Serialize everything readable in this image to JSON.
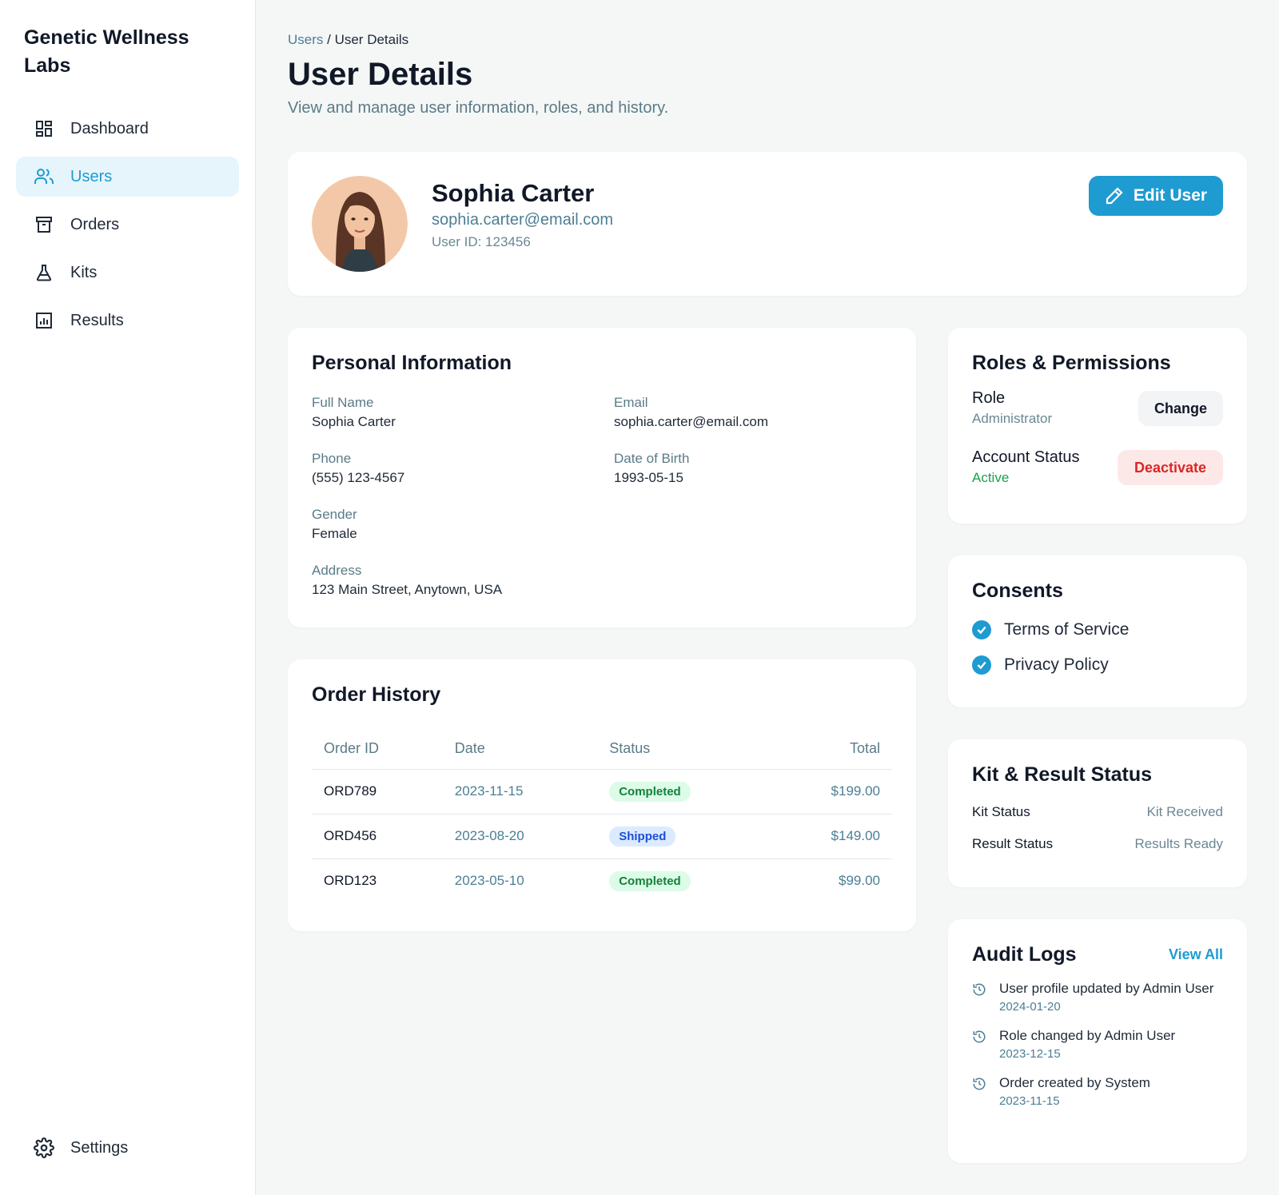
{
  "brand": "Genetic Wellness Labs",
  "nav": {
    "items": [
      {
        "label": "Dashboard",
        "icon": "dashboard-icon"
      },
      {
        "label": "Users",
        "icon": "users-icon"
      },
      {
        "label": "Orders",
        "icon": "archive-icon"
      },
      {
        "label": "Kits",
        "icon": "flask-icon"
      },
      {
        "label": "Results",
        "icon": "bar-chart-icon"
      }
    ],
    "active": "Users",
    "settings": "Settings"
  },
  "breadcrumb": {
    "parent": "Users",
    "separator": " / ",
    "current": "User Details"
  },
  "page": {
    "title": "User Details",
    "subtitle": "View and manage user information, roles, and history."
  },
  "profile": {
    "name": "Sophia Carter",
    "email": "sophia.carter@email.com",
    "user_id": "User ID: 123456",
    "edit_label": "Edit User"
  },
  "personal": {
    "title": "Personal Information",
    "fields": {
      "full_name": {
        "label": "Full Name",
        "value": "Sophia Carter"
      },
      "email": {
        "label": "Email",
        "value": "sophia.carter@email.com"
      },
      "phone": {
        "label": "Phone",
        "value": "(555) 123-4567"
      },
      "dob": {
        "label": "Date of Birth",
        "value": "1993-05-15"
      },
      "gender": {
        "label": "Gender",
        "value": "Female"
      },
      "address": {
        "label": "Address",
        "value": "123 Main Street, Anytown, USA"
      }
    }
  },
  "orders": {
    "title": "Order History",
    "columns": [
      "Order ID",
      "Date",
      "Status",
      "Total"
    ],
    "rows": [
      {
        "id": "ORD789",
        "date": "2023-11-15",
        "status": "Completed",
        "total": "$199.00"
      },
      {
        "id": "ORD456",
        "date": "2023-08-20",
        "status": "Shipped",
        "total": "$149.00"
      },
      {
        "id": "ORD123",
        "date": "2023-05-10",
        "status": "Completed",
        "total": "$99.00"
      }
    ]
  },
  "roles": {
    "title": "Roles & Permissions",
    "role_label": "Role",
    "role_value": "Administrator",
    "change_label": "Change",
    "status_label": "Account Status",
    "status_value": "Active",
    "deactivate_label": "Deactivate"
  },
  "consents": {
    "title": "Consents",
    "items": [
      "Terms of Service",
      "Privacy Policy"
    ]
  },
  "kit": {
    "title": "Kit & Result Status",
    "kit_label": "Kit Status",
    "kit_value": "Kit Received",
    "result_label": "Result Status",
    "result_value": "Results Ready"
  },
  "audit": {
    "title": "Audit Logs",
    "view_all": "View All",
    "logs": [
      {
        "text": "User profile updated by Admin User",
        "date": "2024-01-20"
      },
      {
        "text": "Role changed by Admin User",
        "date": "2023-12-15"
      },
      {
        "text": "Order created by System",
        "date": "2023-11-15"
      }
    ]
  },
  "colors": {
    "accent": "#1e9bd1",
    "success": "#16a34a",
    "danger": "#dc2626"
  }
}
